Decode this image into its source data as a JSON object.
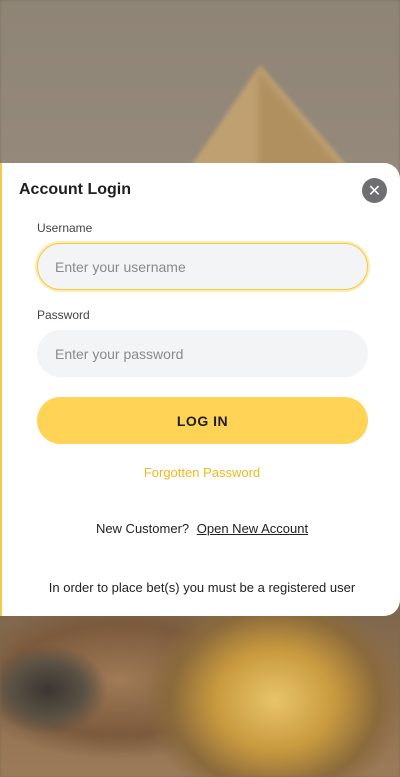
{
  "dialog": {
    "title": "Account Login",
    "close_icon": "close-icon"
  },
  "username": {
    "label": "Username",
    "placeholder": "Enter your username",
    "value": ""
  },
  "password": {
    "label": "Password",
    "placeholder": "Enter your password",
    "value": ""
  },
  "login_button": "LOG IN",
  "forgot_password": "Forgotten Password",
  "new_customer": {
    "prompt": "New Customer?",
    "link": "Open New Account"
  },
  "notice": "In order to place bet(s) you must be a registered user",
  "colors": {
    "accent": "#ffd456",
    "link_accent": "#f0b71e",
    "close_button": "#6f6f72",
    "input_bg": "#f3f4f6"
  }
}
